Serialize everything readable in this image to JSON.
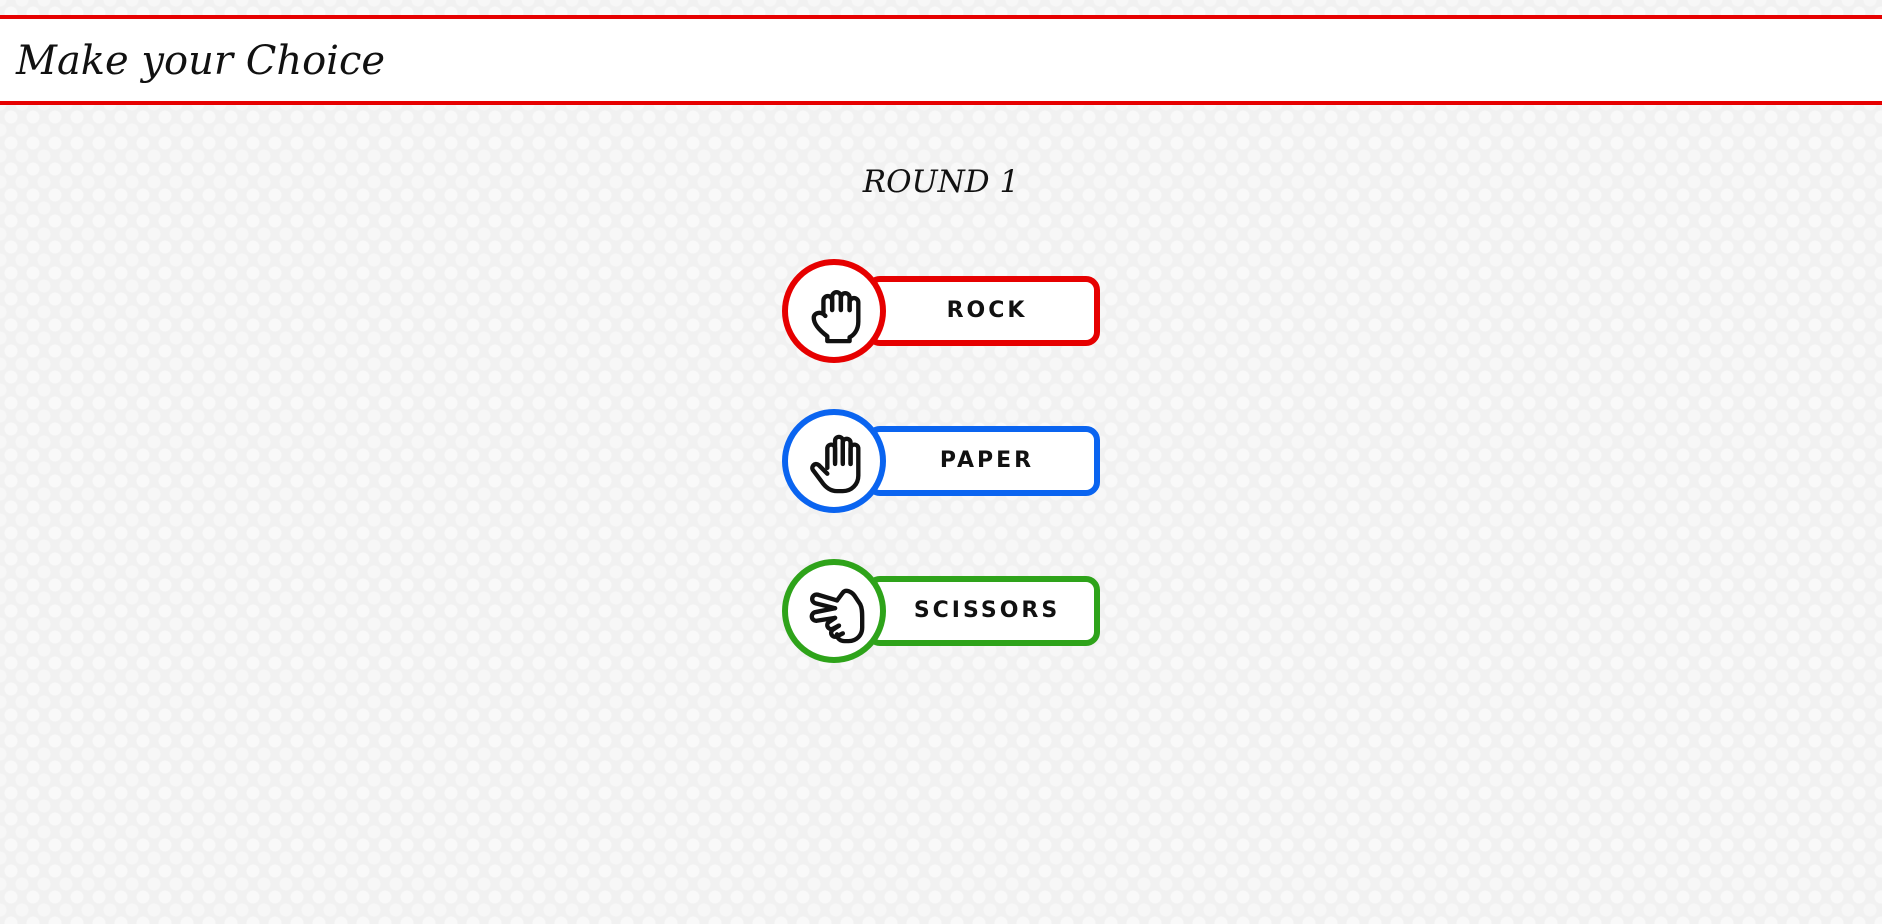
{
  "header": {
    "title": "Make your Choice"
  },
  "round": {
    "label": "ROUND 1"
  },
  "choices": [
    {
      "label": "ROCK",
      "icon": "fist-icon",
      "color": "#e60000"
    },
    {
      "label": "PAPER",
      "icon": "open-hand-icon",
      "color": "#0a64f0"
    },
    {
      "label": "SCISSORS",
      "icon": "scissors-hand-icon",
      "color": "#2ea31a"
    }
  ],
  "colors": {
    "header_border": "#e60000",
    "background": "#f1f1f1",
    "text": "#111111"
  }
}
